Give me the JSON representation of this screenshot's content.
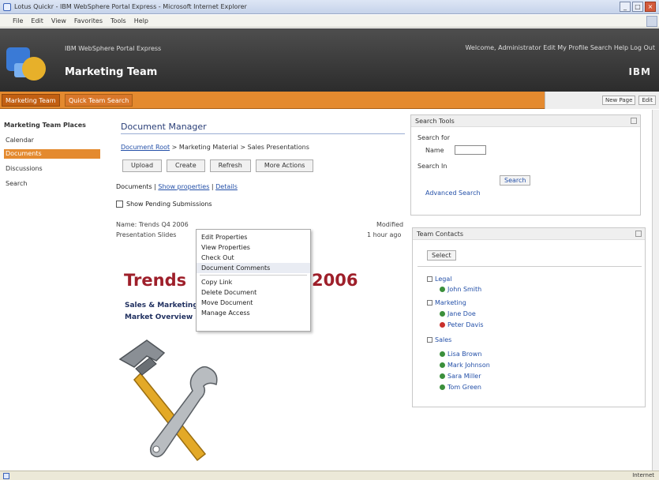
{
  "browser": {
    "title": "Lotus Quickr - IBM WebSphere Portal Express - Microsoft Internet Explorer",
    "menu": [
      "File",
      "Edit",
      "View",
      "Favorites",
      "Tools",
      "Help"
    ],
    "status": "Internet"
  },
  "header": {
    "site_label": "IBM WebSphere Portal Express",
    "site_title": "Marketing Team",
    "welcome": "Welcome, Administrator  Edit My Profile  Search  Help  Log Out",
    "brand": "IBM"
  },
  "navbar": {
    "tabs": [
      "Marketing Team",
      "Quick Team Search"
    ],
    "right_buttons": [
      "New Page",
      "Edit"
    ]
  },
  "sidebar": {
    "heading": "Marketing Team Places",
    "items": [
      {
        "label": "Calendar",
        "active": false
      },
      {
        "label": "Documents",
        "active": true
      },
      {
        "label": "Discussions",
        "active": false
      },
      {
        "label": "Search",
        "active": false
      }
    ]
  },
  "main": {
    "title": "Document Manager",
    "breadcrumb": {
      "link": "Document Root",
      "rest": " > Marketing Material > Sales Presentations"
    },
    "actions": [
      "Upload",
      "Create",
      "Refresh",
      "More Actions"
    ],
    "subactions": {
      "prefix": "Documents | ",
      "link1": "Show properties",
      "link2": "Details"
    },
    "checkbox_label": "Show Pending Submissions",
    "row1_left": "Name: Trends Q4 2006",
    "row1_right": "Modified",
    "row2_left": "Presentation Slides",
    "row2_right": "1 hour ago",
    "context_menu": [
      "Edit Properties",
      "View Properties",
      "Check Out",
      "Document Comments",
      "Copy Link",
      "Delete Document",
      "Move Document",
      "Manage Access"
    ],
    "doc_heading_left": "Trends",
    "doc_heading_right": "2006",
    "doc_meta1": "Sales & Marketing",
    "doc_meta2": "Market Overview"
  },
  "portlets": {
    "search": {
      "title": "Search Tools",
      "label1": "Search for",
      "field_label": "Name",
      "label2": "Search In",
      "button": "Search",
      "link": "Advanced Search"
    },
    "contacts": {
      "title": "Team Contacts",
      "select": "Select",
      "groups": [
        {
          "name": "Legal",
          "members": [
            "John Smith"
          ]
        },
        {
          "name": "Marketing",
          "members": [
            "Jane Doe",
            "Peter Davis"
          ]
        },
        {
          "name": "Sales",
          "members": [
            "Lisa Brown",
            "Mark Johnson",
            "Sara Miller",
            "Tom Green"
          ]
        }
      ]
    }
  }
}
